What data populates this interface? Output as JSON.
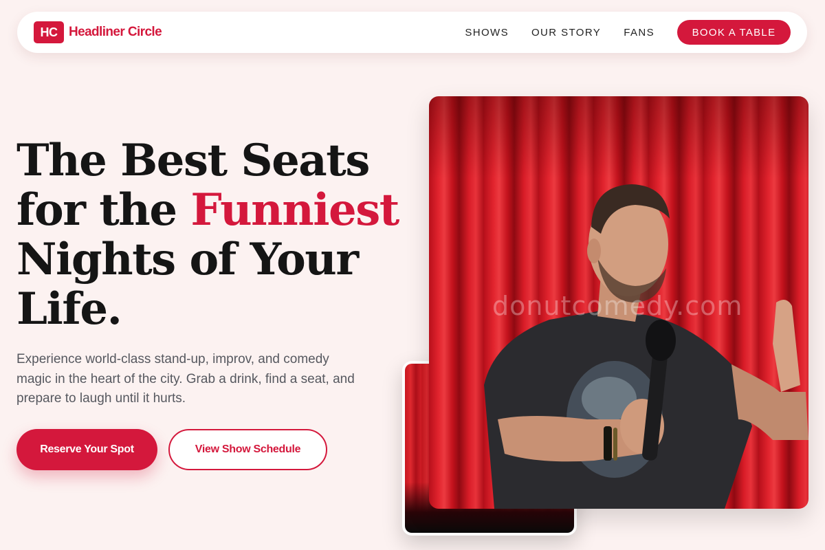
{
  "brand": {
    "mark": "HC",
    "name": "Headliner Circle",
    "accent_color": "#d4183c"
  },
  "nav": {
    "links": [
      {
        "label": "SHOWS"
      },
      {
        "label": "OUR STORY"
      },
      {
        "label": "FANS"
      }
    ],
    "cta": "BOOK A TABLE"
  },
  "hero": {
    "headline_before": "The Best Seats for the ",
    "headline_accent": "Funniest",
    "headline_after": " Nights of Your Life.",
    "description": "Experience world-class stand-up, improv, and comedy magic in the heart of the city. Grab a drink, find a seat, and prepare to laugh until it hurts.",
    "primary_button": "Reserve Your Spot",
    "secondary_button": "View Show Schedule"
  },
  "media": {
    "main_photo_icon": "comedian-on-stage-photo",
    "secondary_photo_icon": "stage-curtain-photo",
    "watermark": "donutcomedy.com"
  }
}
